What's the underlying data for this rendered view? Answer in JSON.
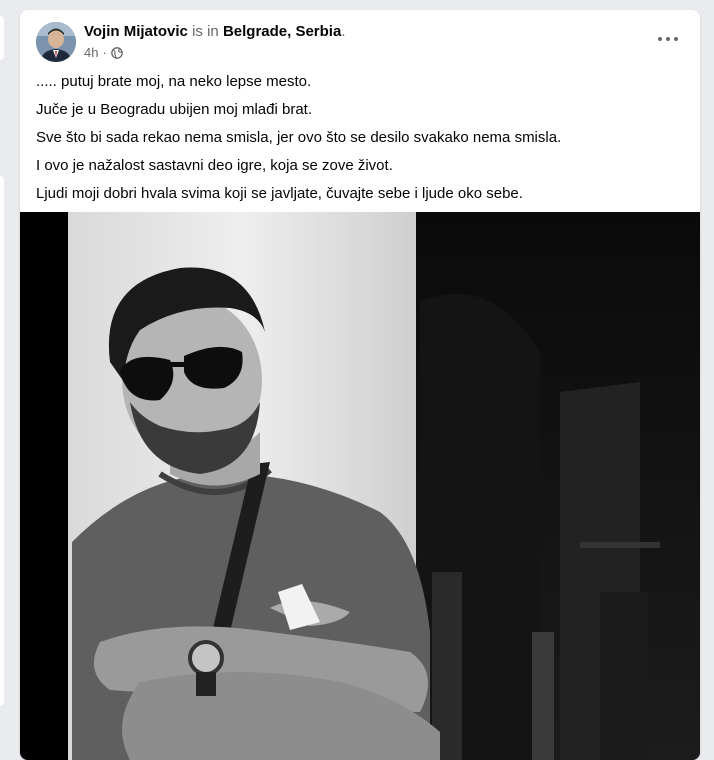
{
  "post": {
    "author": "Vojin Mijatovic",
    "connector": "is in",
    "location": "Belgrade, Serbia",
    "period": ".",
    "time": "4h",
    "separator": "·",
    "privacy_icon": "globe-icon",
    "more_icon": "more-options-icon",
    "lines": [
      "..... putuj brate moj, na neko lepse mesto.",
      "Juče je u Beogradu ubijen moj mlađi brat.",
      "Sve što bi sada rekao nema smisla, jer ovo što se desilo svakako nema smisla.",
      "I ovo je nažalost sastavni deo igre, koja se zove život.",
      "Ljudi moji dobri hvala svima koji se javljate, čuvajte sebe i ljude oko sebe."
    ]
  },
  "colors": {
    "background": "#e9ebee",
    "card": "#ffffff",
    "text_primary": "#050505",
    "text_secondary": "#65676b"
  }
}
